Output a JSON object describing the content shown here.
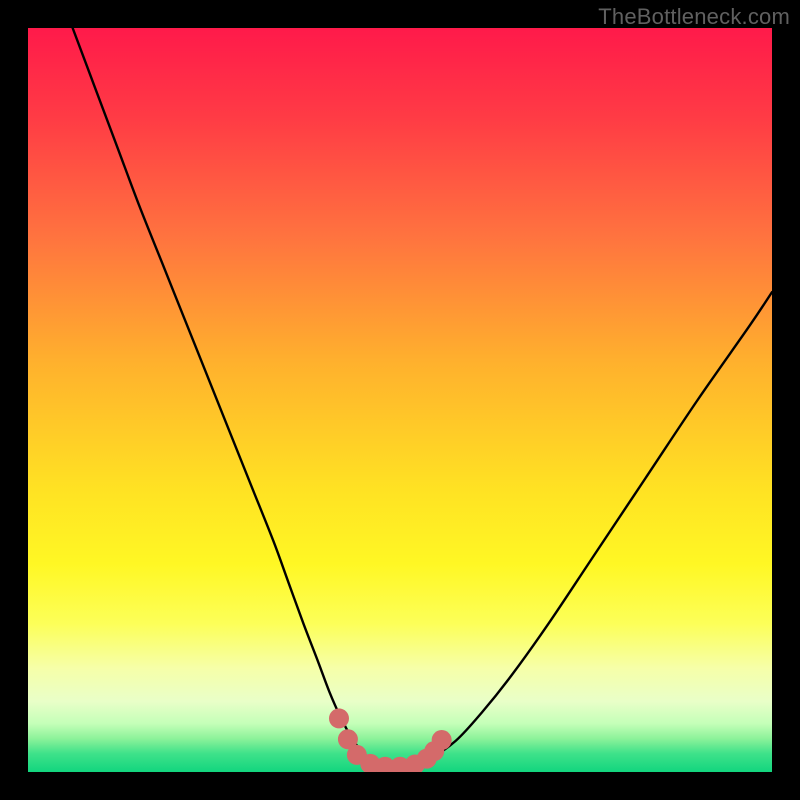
{
  "watermark": "TheBottleneck.com",
  "colors": {
    "black": "#000000",
    "curve_stroke": "#000000",
    "marker_fill": "#d46a6a",
    "marker_stroke": "#c85a5a"
  },
  "chart_data": {
    "type": "line",
    "title": "",
    "xlabel": "",
    "ylabel": "",
    "xlim": [
      0,
      100
    ],
    "ylim": [
      0,
      100
    ],
    "annotations": [
      "TheBottleneck.com"
    ],
    "gradient_stops": [
      {
        "offset": 0.0,
        "color": "#ff1a4a"
      },
      {
        "offset": 0.12,
        "color": "#ff3b45"
      },
      {
        "offset": 0.28,
        "color": "#ff733f"
      },
      {
        "offset": 0.45,
        "color": "#ffb12d"
      },
      {
        "offset": 0.62,
        "color": "#ffe223"
      },
      {
        "offset": 0.72,
        "color": "#fff724"
      },
      {
        "offset": 0.8,
        "color": "#fcff58"
      },
      {
        "offset": 0.86,
        "color": "#f6ffa8"
      },
      {
        "offset": 0.905,
        "color": "#e9ffc8"
      },
      {
        "offset": 0.935,
        "color": "#c4ffb8"
      },
      {
        "offset": 0.955,
        "color": "#8df29a"
      },
      {
        "offset": 0.975,
        "color": "#3fe28a"
      },
      {
        "offset": 1.0,
        "color": "#12d57e"
      }
    ],
    "series": [
      {
        "name": "bottleneck-curve",
        "x": [
          6.0,
          9.0,
          12.0,
          15.0,
          18.0,
          21.0,
          24.0,
          27.0,
          30.0,
          33.0,
          35.0,
          37.0,
          39.0,
          40.5,
          42.0,
          43.5,
          45.0,
          47.0,
          49.0,
          51.0,
          54.0,
          57.5,
          61.0,
          65.0,
          70.0,
          76.0,
          83.0,
          90.0,
          97.0,
          100.0
        ],
        "y": [
          100.0,
          92.0,
          84.0,
          76.0,
          68.5,
          61.0,
          53.5,
          46.0,
          38.5,
          31.0,
          25.5,
          20.0,
          14.8,
          10.8,
          7.4,
          4.6,
          2.6,
          1.2,
          0.6,
          0.8,
          1.8,
          4.2,
          8.0,
          13.0,
          20.0,
          29.0,
          39.5,
          50.0,
          60.0,
          64.5
        ]
      }
    ],
    "markers": {
      "name": "bottom-cluster",
      "points": [
        {
          "x": 41.8,
          "y": 7.2
        },
        {
          "x": 43.0,
          "y": 4.4
        },
        {
          "x": 44.2,
          "y": 2.3
        },
        {
          "x": 46.0,
          "y": 1.1
        },
        {
          "x": 48.0,
          "y": 0.7
        },
        {
          "x": 50.0,
          "y": 0.7
        },
        {
          "x": 52.0,
          "y": 1.0
        },
        {
          "x": 53.6,
          "y": 1.8
        },
        {
          "x": 54.6,
          "y": 2.8
        },
        {
          "x": 55.6,
          "y": 4.3
        }
      ],
      "radius": 10
    }
  }
}
